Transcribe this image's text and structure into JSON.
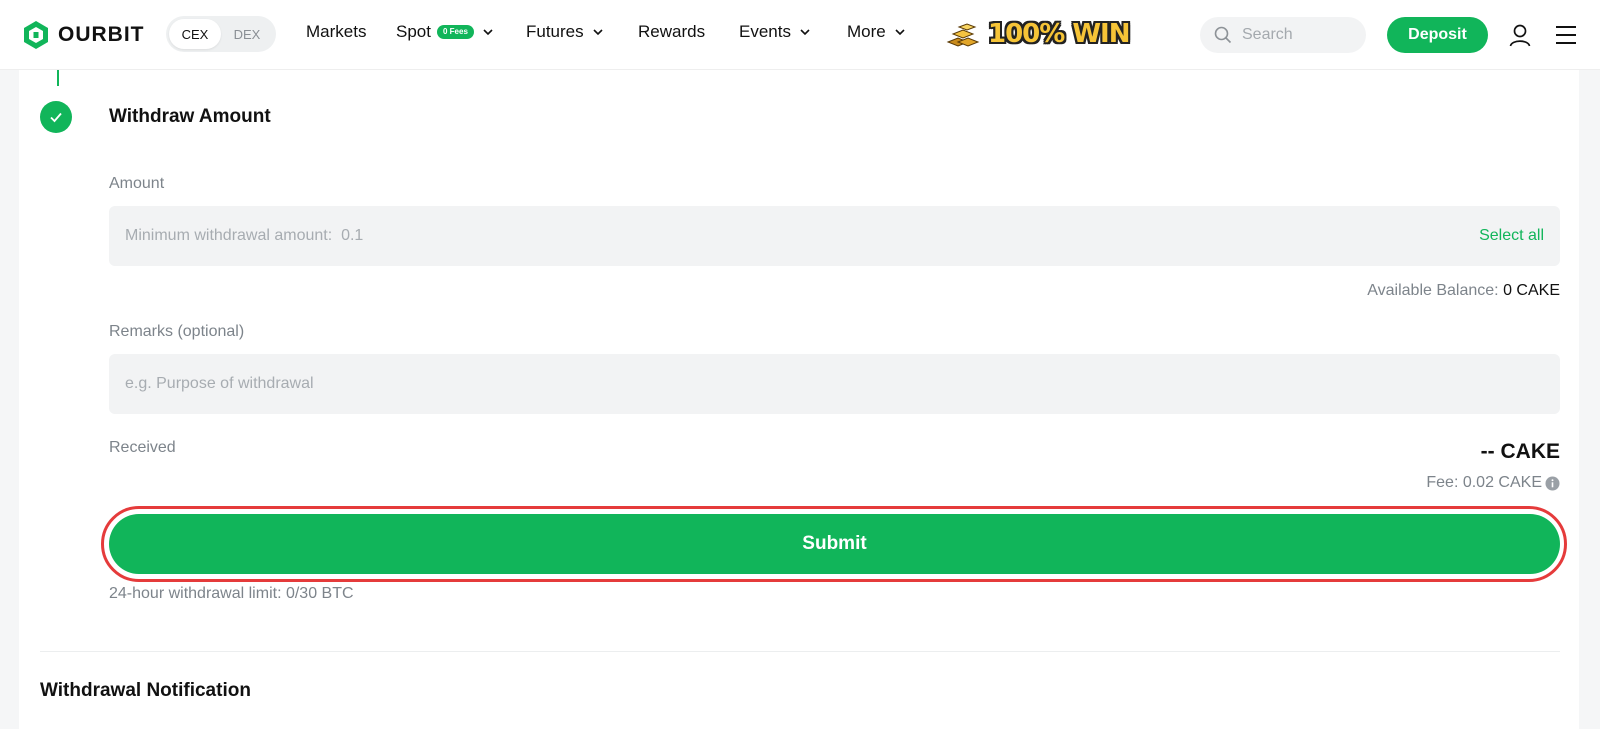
{
  "header": {
    "logo_text": "OURBIT",
    "mode_toggle": {
      "options": [
        "CEX",
        "DEX"
      ],
      "active": "CEX"
    },
    "nav": {
      "markets": "Markets",
      "spot": "Spot",
      "spot_badge": "0 Fees",
      "futures": "Futures",
      "rewards": "Rewards",
      "events": "Events",
      "more": "More"
    },
    "promo_text": "100% WIN",
    "search_placeholder": "Search",
    "deposit_label": "Deposit",
    "icons": [
      "search-icon",
      "user-icon",
      "menu-icon",
      "chevron-down-icon"
    ]
  },
  "withdraw": {
    "step_title": "Withdraw Amount",
    "amount": {
      "label": "Amount",
      "placeholder": "Minimum withdrawal amount:  0.1",
      "value": "",
      "select_all": "Select all"
    },
    "balance_label": "Available Balance:",
    "balance_value": "0 CAKE",
    "remarks": {
      "label": "Remarks (optional)",
      "placeholder": "e.g. Purpose of withdrawal",
      "value": ""
    },
    "received_label": "Received",
    "received_value": "-- CAKE",
    "fee_text": "Fee: 0.02 CAKE",
    "submit_label": "Submit",
    "limit_text": "24-hour withdrawal limit: 0/30 BTC"
  },
  "notification_title": "Withdrawal Notification",
  "colors": {
    "accent": "#11b55a",
    "highlight_ring": "#e53b3b",
    "page_bg": "#f5f6f7",
    "input_bg": "#f2f3f4"
  }
}
